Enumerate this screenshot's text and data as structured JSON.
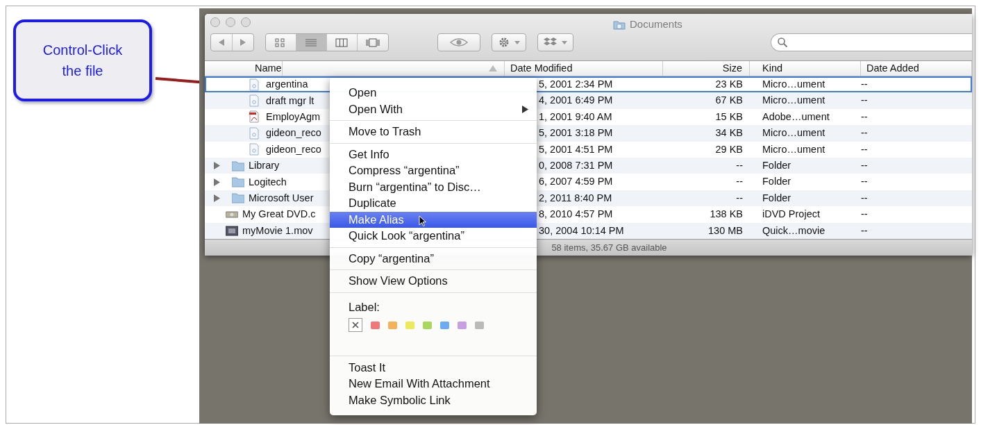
{
  "callout": {
    "text": "Control-Click the file"
  },
  "window": {
    "title": "Documents",
    "views": [
      {
        "kind": "icon",
        "selected": false
      },
      {
        "kind": "list",
        "selected": true
      },
      {
        "kind": "column",
        "selected": false
      },
      {
        "kind": "coverflow",
        "selected": false
      }
    ],
    "columns": [
      "Name",
      "Date Modified",
      "Size",
      "Kind",
      "Date Added"
    ],
    "rows": [
      {
        "kind": "doc",
        "name": "argentina",
        "modified": "5, 2001 2:34 PM",
        "size": "23 KB",
        "file_kind": "Micro…ument",
        "added": "--",
        "selected": true
      },
      {
        "kind": "doc",
        "name": "draft mgr lt",
        "modified": "4, 2001 6:49 PM",
        "size": "67 KB",
        "file_kind": "Micro…ument",
        "added": "--",
        "selected": false
      },
      {
        "kind": "pdf",
        "name": "EmployAgm",
        "modified": "1, 2001 9:40 AM",
        "size": "15 KB",
        "file_kind": "Adobe…ument",
        "added": "--",
        "selected": false
      },
      {
        "kind": "doc",
        "name": "gideon_reco",
        "modified": "5, 2001 3:18 PM",
        "size": "34 KB",
        "file_kind": "Micro…ument",
        "added": "--",
        "selected": false
      },
      {
        "kind": "doc",
        "name": "gideon_reco",
        "modified": "5, 2001 4:51 PM",
        "size": "29 KB",
        "file_kind": "Micro…ument",
        "added": "--",
        "selected": false
      },
      {
        "kind": "folder",
        "expanded": false,
        "name": "Library",
        "modified": "0, 2008 7:31 PM",
        "size": "--",
        "file_kind": "Folder",
        "added": "--",
        "selected": false
      },
      {
        "kind": "folder",
        "expanded": false,
        "name": "Logitech",
        "modified": "6, 2007 4:59 PM",
        "size": "--",
        "file_kind": "Folder",
        "added": "--",
        "selected": false
      },
      {
        "kind": "folder",
        "expanded": false,
        "name": "Microsoft User",
        "modified": "2, 2011 8:40 PM",
        "size": "--",
        "file_kind": "Folder",
        "added": "--",
        "selected": false
      },
      {
        "kind": "dvd",
        "name": "My Great DVD.c",
        "modified": "8, 2010 4:57 PM",
        "size": "138 KB",
        "file_kind": "iDVD Project",
        "added": "--",
        "selected": false
      },
      {
        "kind": "movie",
        "name": "myMovie 1.mov",
        "modified": "30, 2004 10:14 PM",
        "size": "130 MB",
        "file_kind": "Quick…movie",
        "added": "--",
        "selected": false
      }
    ],
    "status": "58 items, 35.67 GB available"
  },
  "menu": {
    "groups": [
      [
        {
          "kind": "command",
          "label": "Open",
          "submenu": false,
          "selected": false
        },
        {
          "kind": "command",
          "label": "Open With",
          "submenu": true,
          "selected": false
        }
      ],
      [
        {
          "kind": "command",
          "label": "Move to Trash",
          "submenu": false,
          "selected": false
        }
      ],
      [
        {
          "kind": "command",
          "label": "Get Info",
          "submenu": false,
          "selected": false
        },
        {
          "kind": "command",
          "label": "Compress “argentina”",
          "submenu": false,
          "selected": false
        },
        {
          "kind": "command",
          "label": "Burn “argentina” to Disc…",
          "submenu": false,
          "selected": false
        },
        {
          "kind": "command",
          "label": "Duplicate",
          "submenu": false,
          "selected": false
        },
        {
          "kind": "command",
          "label": "Make Alias",
          "submenu": false,
          "selected": true
        },
        {
          "kind": "command",
          "label": "Quick Look “argentina”",
          "submenu": false,
          "selected": false
        }
      ],
      [
        {
          "kind": "command",
          "label": "Copy “argentina”",
          "submenu": false,
          "selected": false
        }
      ],
      [
        {
          "kind": "command",
          "label": "Show View Options",
          "submenu": false,
          "selected": false
        }
      ],
      [
        {
          "kind": "labels",
          "label": "Label:",
          "swatches": [
            {
              "color": "#f07878"
            },
            {
              "color": "#f4b25a"
            },
            {
              "color": "#ece95a"
            },
            {
              "color": "#a8d85c"
            },
            {
              "color": "#6cacf2"
            },
            {
              "color": "#c89ee4"
            },
            {
              "color": "#bababa"
            }
          ]
        }
      ],
      [
        {
          "kind": "command",
          "label": "Toast It",
          "submenu": false,
          "selected": false
        },
        {
          "kind": "command",
          "label": "New Email With Attachment",
          "submenu": false,
          "selected": false
        },
        {
          "kind": "command",
          "label": "Make Symbolic Link",
          "submenu": false,
          "selected": false
        }
      ]
    ]
  }
}
